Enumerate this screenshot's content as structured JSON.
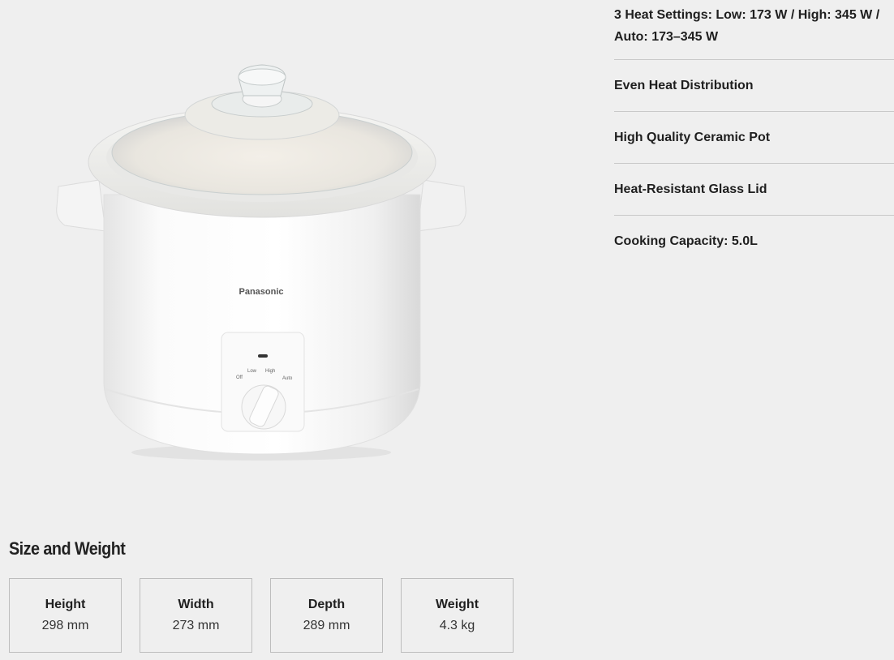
{
  "product": {
    "brand": "Panasonic",
    "dial_labels": {
      "off": "Off",
      "low": "Low",
      "high": "High",
      "auto": "Auto"
    }
  },
  "features": [
    {
      "text": "3 Heat Settings: Low: 173 W / High: 345 W / Auto: 173–345 W"
    },
    {
      "text": "Even Heat Distribution"
    },
    {
      "text": "High Quality Ceramic Pot"
    },
    {
      "text": "Heat-Resistant Glass Lid"
    },
    {
      "text": "Cooking Capacity: 5.0L"
    }
  ],
  "size_weight": {
    "title": "Size and Weight",
    "items": [
      {
        "label": "Height",
        "value": "298 mm"
      },
      {
        "label": "Width",
        "value": "273 mm"
      },
      {
        "label": "Depth",
        "value": "289 mm"
      },
      {
        "label": "Weight",
        "value": "4.3 kg"
      }
    ]
  }
}
